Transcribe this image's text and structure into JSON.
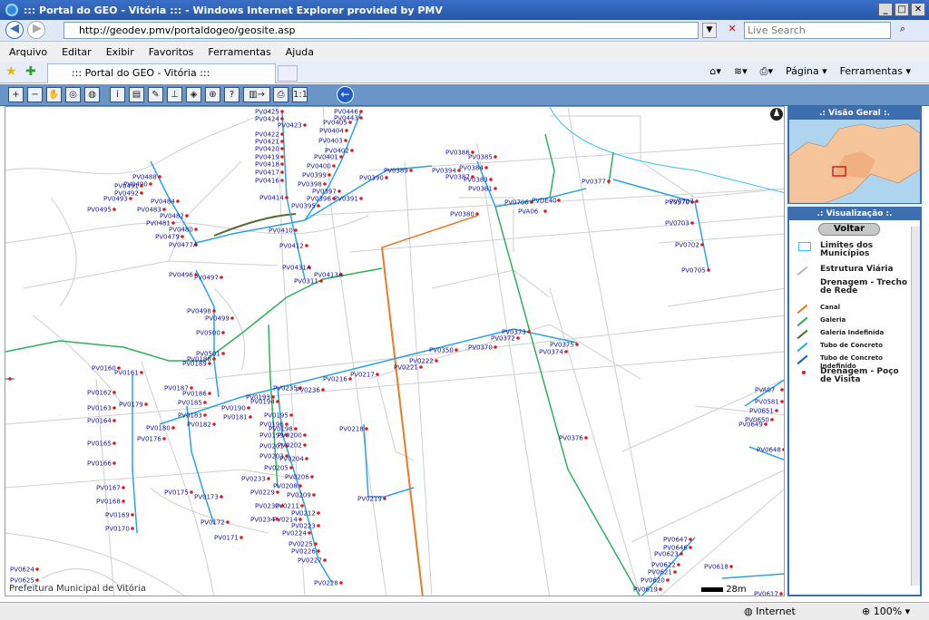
{
  "window": {
    "title": "::: Portal do GEO - Vitória ::: - Windows Internet Explorer provided by PMV"
  },
  "address": {
    "url": "http://geodev.pmv/portaldogeo/geosite.asp",
    "search_placeholder": "Live Search"
  },
  "menu": [
    "Arquivo",
    "Editar",
    "Exibir",
    "Favoritos",
    "Ferramentas",
    "Ajuda"
  ],
  "tab": {
    "title": "::: Portal do GEO - Vitória :::",
    "pagina": "Página",
    "ferramentas": "Ferramentas"
  },
  "maptools": {
    "ratio_label": "1:1"
  },
  "panel": {
    "overview_title": ".: Visão Geral :.",
    "vis_title": ".: Visualização :.",
    "voltar": "Voltar",
    "legend": [
      {
        "label": "Limites dos Municípios",
        "color": "#39c6e6"
      },
      {
        "label": "Estrutura Viária",
        "color": "#bbbbbb"
      },
      {
        "label": "Drenagem - Trecho de Rede",
        "color": ""
      },
      {
        "label": "Canal",
        "color": "#f07820"
      },
      {
        "label": "Galeria",
        "color": "#2ab25a"
      },
      {
        "label": "Galeria Indefinida",
        "color": "#556b2f"
      },
      {
        "label": "Tubo de Concreto",
        "color": "#29a3e6"
      },
      {
        "label": "Tubo de Concreto Indefinido",
        "color": "#1b5fb5"
      },
      {
        "label": "Drenagem - Poço de Visita",
        "color": "#e01a1a"
      }
    ]
  },
  "map": {
    "footer": "Prefeitura Municipal de Vitória",
    "scale": "28m",
    "labels": [
      "PV0425",
      "PV0424",
      "PV0423",
      "PV0422",
      "PV0421",
      "PV0420",
      "PV0419",
      "PV0418",
      "PV0417",
      "PV0416",
      "PV0414",
      "PV0410",
      "PV0412",
      "PV0431A",
      "PV0413A",
      "PV0311",
      "PV0446",
      "PV0443",
      "PV0405",
      "PV0404",
      "PV0403",
      "PV0402",
      "PV0401",
      "PV0400",
      "PV0399",
      "PV0398",
      "PV0397",
      "PV0396",
      "PV0395",
      "PV0391",
      "PV0390",
      "PV0389",
      "PV0386",
      "PV0385",
      "PV0384",
      "PV0383",
      "PV0387",
      "PV0381",
      "PV0380",
      "PV0394",
      "PV0488",
      "PV0490",
      "PV0491",
      "PV0492",
      "PV0493",
      "PV0495",
      "PV0484",
      "PV0483",
      "PV0482",
      "PV0481",
      "PV0480",
      "PV0479",
      "PV0477A",
      "PV0497",
      "PV0496",
      "PV0498",
      "PV0499",
      "PV0500",
      "PV0501",
      "PV0188",
      "PV0189",
      "PV0160",
      "PV0161",
      "PV0162",
      "PV0163",
      "PV0164",
      "PV0179",
      "PV0180",
      "PV0176",
      "PV0165",
      "PV0166",
      "PV0167",
      "PV0168",
      "PV0169",
      "PV0170",
      "PV0175",
      "PV0173",
      "PV0172",
      "PV0171",
      "PV0187",
      "PV0186",
      "PV0185",
      "PV0183",
      "PV0182",
      "PV0181",
      "PV0190",
      "PV0193",
      "PV0194",
      "PV0195",
      "PV0196",
      "PV0198",
      "PV0199",
      "PV0200",
      "PV0201",
      "PV0202",
      "PV0203",
      "PV0204",
      "PV0205",
      "PV0206",
      "PV0208",
      "PV0209",
      "PV0211",
      "PV0212",
      "PV0214",
      "PV0223",
      "PV0224",
      "PV0225",
      "PV0226",
      "PV0227",
      "PV0228",
      "PV0229",
      "PV0230",
      "PV0233",
      "PV0234",
      "PV0235",
      "PV0236",
      "PV0216",
      "PV0217",
      "PV0218",
      "PV0219",
      "PV0221",
      "PV0222",
      "PV0350",
      "PV0370",
      "PV0372",
      "PV0373",
      "PV0374",
      "PV0375",
      "PV0376",
      "PV0377",
      "PV0570",
      "PV0707",
      "PV0703",
      "PV0702",
      "PV0705",
      "PV0706",
      "PVDE40",
      "PVA06",
      "PVA10",
      "PVA07",
      "PV0581",
      "PV0651",
      "PV0650",
      "PV0649",
      "PV0648",
      "PV0647",
      "PV0646",
      "PV0623",
      "PV0622",
      "PV0621",
      "PV0620",
      "PV0619",
      "PV0618",
      "PV0617",
      "PV0624",
      "PV0625",
      "PV0246",
      "PV0245"
    ]
  },
  "status": {
    "zone": "Internet",
    "zoom": "100%"
  }
}
